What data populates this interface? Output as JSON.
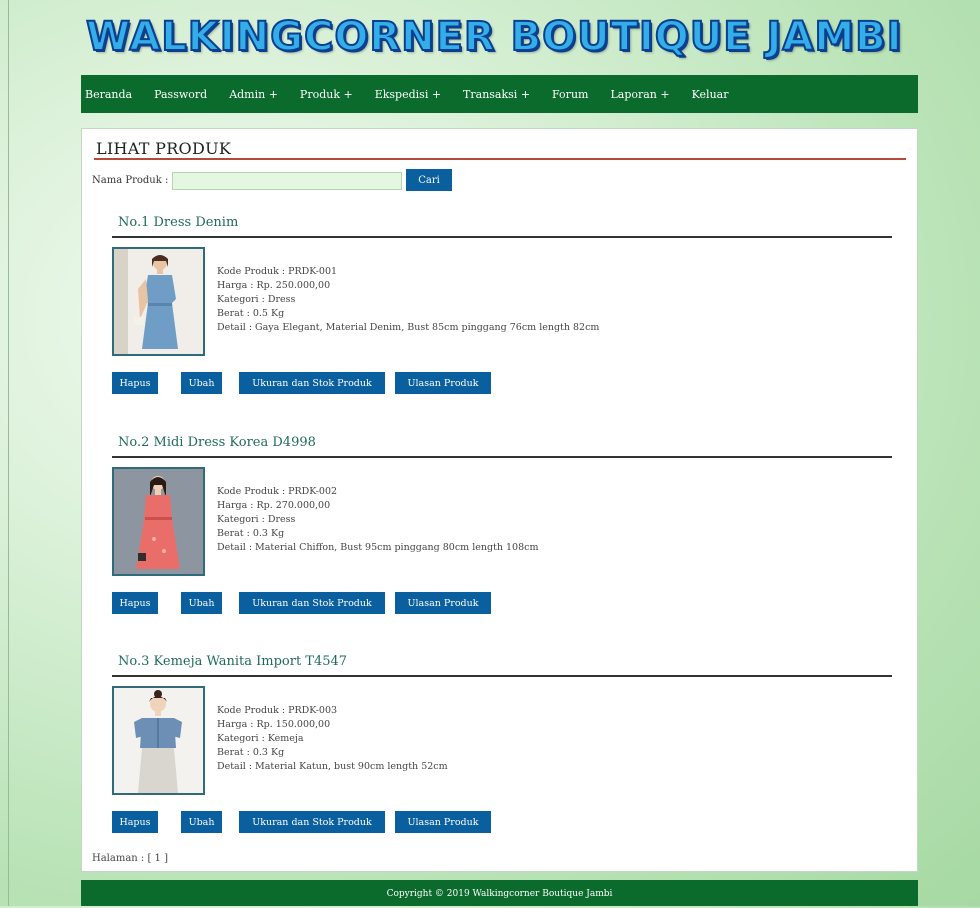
{
  "header": {
    "logo_text": "WALKINGCORNER BOUTIQUE JAMBI"
  },
  "nav": {
    "items": [
      "Beranda",
      "Password",
      "Admin +",
      "Produk +",
      "Ekspedisi +",
      "Transaksi +",
      "Forum",
      "Laporan +",
      "Keluar"
    ]
  },
  "page": {
    "title": "LIHAT PRODUK",
    "search_label": "Nama Produk :",
    "search_value": "",
    "search_button": "Cari"
  },
  "products": [
    {
      "title": "No.1 Dress Denim",
      "kode": "Kode Produk : PRDK-001",
      "harga": "Harga : Rp. 250.000,00",
      "kategori": "Kategori : Dress",
      "berat": "Berat : 0.5 Kg",
      "detail": "Detail : Gaya Elegant, Material Denim, Bust 85cm pinggang 76cm length 82cm",
      "image_icon": "dress-denim-photo"
    },
    {
      "title": "No.2 Midi Dress Korea D4998",
      "kode": "Kode Produk : PRDK-002",
      "harga": "Harga : Rp. 270.000,00",
      "kategori": "Kategori : Dress",
      "berat": "Berat : 0.3 Kg",
      "detail": "Detail : Material Chiffon, Bust 95cm pinggang 80cm length 108cm",
      "image_icon": "midi-dress-photo"
    },
    {
      "title": "No.3 Kemeja Wanita Import T4547",
      "kode": "Kode Produk : PRDK-003",
      "harga": "Harga : Rp. 150.000,00",
      "kategori": "Kategori : Kemeja",
      "berat": "Berat : 0.3 Kg",
      "detail": "Detail : Material Katun, bust 90cm length 52cm",
      "image_icon": "kemeja-photo"
    }
  ],
  "buttons": {
    "hapus": "Hapus",
    "ubah": "Ubah",
    "ukuran": "Ukuran dan Stok Produk",
    "ulasan": "Ulasan Produk"
  },
  "pagination": {
    "text": "Halaman : [ 1 ]"
  },
  "footer": {
    "text": "Copyright © 2019 Walkingcorner Boutique Jambi"
  },
  "colors": {
    "nav_bg": "#0a6b2c",
    "button_bg": "#0a5f9e",
    "title_rule": "#b64a3a",
    "logo_fill": "#33aee8"
  }
}
